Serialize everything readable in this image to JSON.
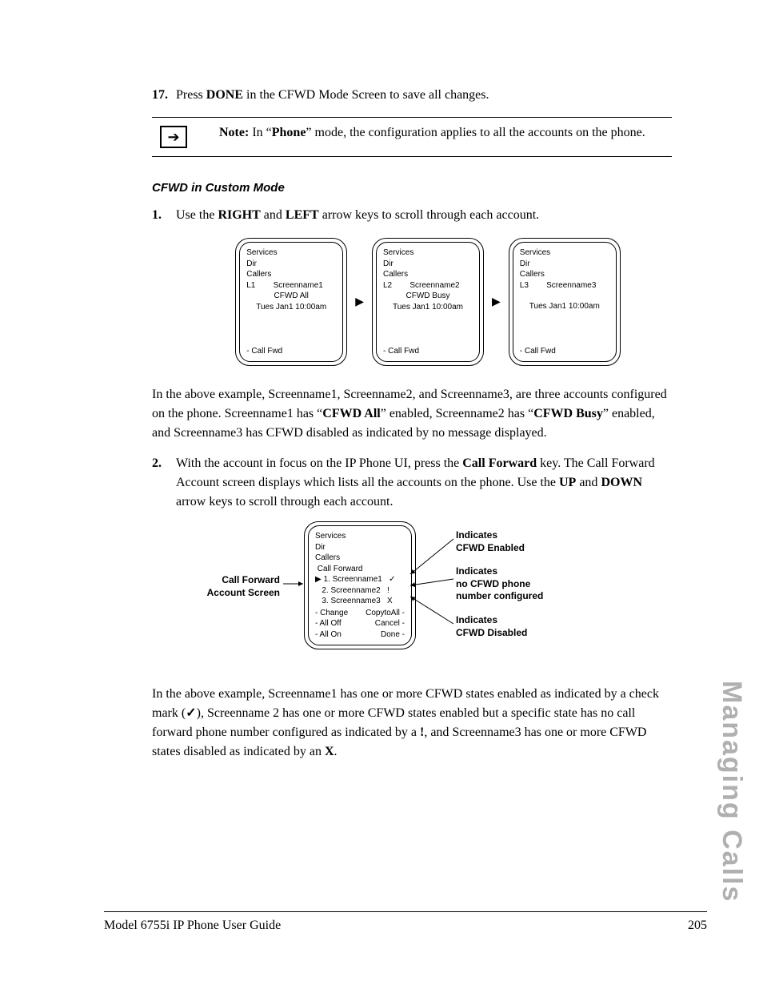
{
  "step17": {
    "num": "17.",
    "pre": "Press ",
    "done": "DONE",
    "post": " in the CFWD Mode Screen to save all changes."
  },
  "note": {
    "label": "Note:",
    "pre": " In “",
    "bold": "Phone",
    "post": "” mode, the configuration applies to all the accounts on the phone."
  },
  "heading": "CFWD in Custom Mode",
  "step1": {
    "num": "1.",
    "pre": "Use the ",
    "right": "RIGHT",
    "mid": " and ",
    "left": "LEFT",
    "post": " arrow keys to scroll through each account."
  },
  "screens": [
    {
      "lines": [
        "Services",
        "Dir",
        "Callers"
      ],
      "line_account": "L1        Screenname1",
      "status": "CFWD All",
      "time": "Tues Jan1 10:00am",
      "footer": "- Call Fwd"
    },
    {
      "lines": [
        "Services",
        "Dir",
        "Callers"
      ],
      "line_account": "L2        Screenname2",
      "status": "CFWD Busy",
      "time": "Tues Jan1 10:00am",
      "footer": "- Call Fwd"
    },
    {
      "lines": [
        "Services",
        "Dir",
        "Callers"
      ],
      "line_account": "L3        Screenname3",
      "status": "",
      "time": "Tues Jan1 10:00am",
      "footer": "- Call Fwd"
    }
  ],
  "para1": {
    "a": "In the above example, Screenname1, Screenname2, and Screenname3, are three accounts configured on the phone. Screenname1 has “",
    "b": "CFWD All",
    "c": "” enabled, Screenname2 has “",
    "d": "CFWD Busy",
    "e": "” enabled, and Screenname3 has CFWD disabled as indicated by no message displayed."
  },
  "step2": {
    "num": "2.",
    "a": "With the account in focus on the IP Phone UI, press the ",
    "b": "Call Forward",
    "c": " key. The Call Forward Account screen displays which lists all the accounts on the phone. Use the ",
    "d": "UP",
    "e": " and ",
    "f": "DOWN",
    "g": " arrow keys to scroll through each account."
  },
  "cf_label1": "Call Forward",
  "cf_label2": "Account Screen",
  "screen2": {
    "lines": [
      "Services",
      "Dir",
      "Callers"
    ],
    "header": " Call Forward",
    "row1": "▶ 1. Screenname1   ✓",
    "row2": "   2. Screenname2   !",
    "row3": "   3. Screenname3   X",
    "fl1": "- Change",
    "fr1": "CopytoAll -",
    "fl2": "- All Off",
    "fr2": "Cancel -",
    "fl3": "- All On",
    "fr3": "Done -"
  },
  "callouts": {
    "c1a": "Indicates",
    "c1b": "CFWD Enabled",
    "c2a": "Indicates",
    "c2b": "no CFWD phone",
    "c2c": "number configured",
    "c3a": "Indicates",
    "c3b": "CFWD Disabled"
  },
  "para2": {
    "a": "In the above example, Screenname1 has one or more CFWD states enabled as indicated by a check mark (",
    "check": "✓",
    "b": "), Screenname 2 has one or more CFWD states enabled but a specific state has no call forward phone number configured as indicated by a ",
    "bang": "!",
    "c": ", and Screenname3 has one or more CFWD states disabled as indicated by an ",
    "x": "X",
    "d": "."
  },
  "side_tab": "Managing Calls",
  "footer_left": "Model 6755i IP Phone User Guide",
  "footer_right": "205"
}
